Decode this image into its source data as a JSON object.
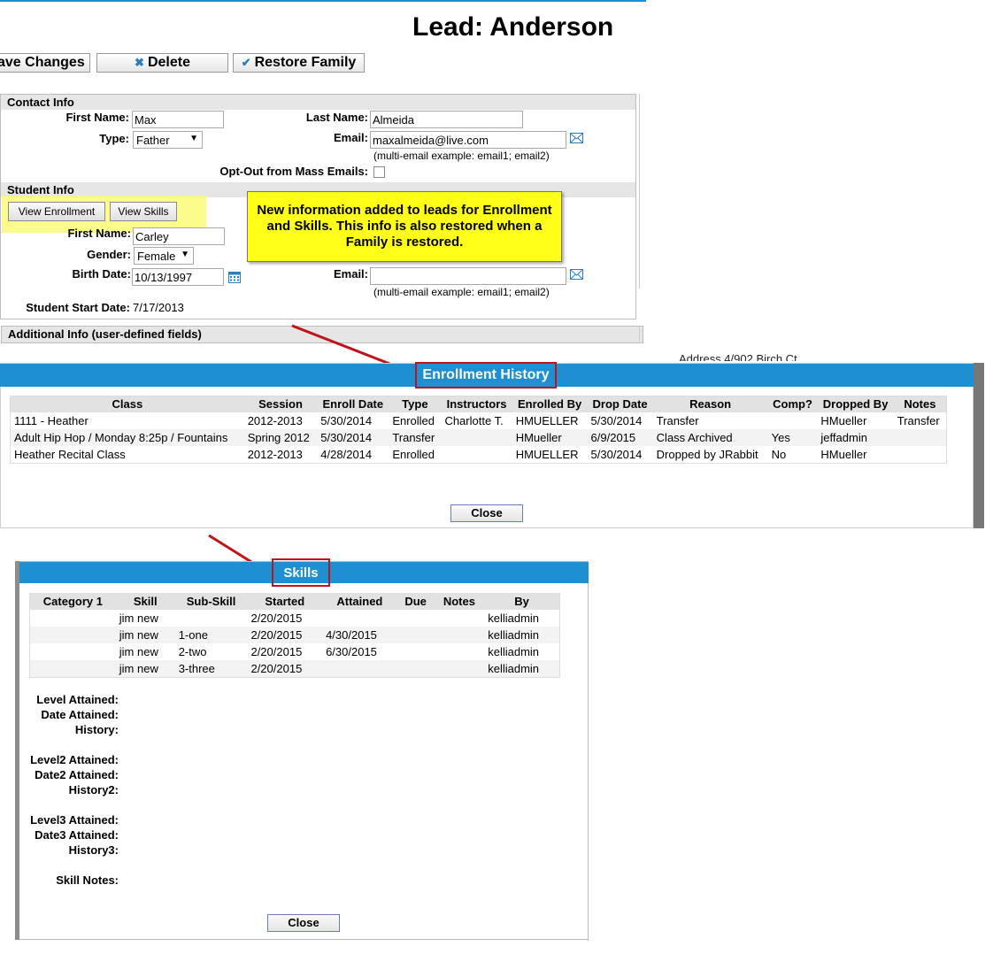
{
  "page": {
    "title": "Lead: Anderson",
    "toolbar": {
      "save_label": "ave Changes",
      "delete_label": "Delete",
      "restore_label": "Restore Family"
    }
  },
  "contact": {
    "section_title": "Contact Info",
    "first_name_label": "First Name:",
    "first_name": "Max",
    "last_name_label": "Last Name:",
    "last_name": "Almeida",
    "type_label": "Type:",
    "type": "Father",
    "email_label": "Email:",
    "email": "maxalmeida@live.com",
    "email_hint": "(multi-email example: email1; email2)",
    "optout_label": "Opt-Out from Mass Emails:"
  },
  "student": {
    "section_title": "Student Info",
    "view_enrollment": "View Enrollment",
    "view_skills": "View Skills",
    "first_name_label": "First Name:",
    "first_name": "Carley",
    "gender_label": "Gender:",
    "gender": "Female",
    "birth_label": "Birth Date:",
    "birth": "10/13/1997",
    "email_label": "Email:",
    "email_hint": "(multi-email example: email1; email2)",
    "start_label": "Student Start Date:",
    "start": "7/17/2013"
  },
  "additional": {
    "section_title": "Additional Info (user-defined fields)"
  },
  "callout": {
    "text": "New information added to leads for Enrollment and Skills. This info is also restored when a Family is restored."
  },
  "background": {
    "address_fragment": "Address 4/902 Birch Ct"
  },
  "enrollment": {
    "title": "Enrollment History",
    "columns": [
      "Class",
      "Session",
      "Enroll Date",
      "Type",
      "Instructors",
      "Enrolled By",
      "Drop Date",
      "Reason",
      "Comp?",
      "Dropped By",
      "Notes"
    ],
    "rows": [
      [
        "1111 - Heather",
        "2012-2013",
        "5/30/2014",
        "Enrolled",
        "Charlotte T.",
        "HMUELLER",
        "5/30/2014",
        "Transfer",
        "",
        "HMueller",
        "Transfer"
      ],
      [
        "Adult Hip Hop / Monday 8:25p / Fountains",
        "Spring 2012",
        "5/30/2014",
        "Transfer",
        "",
        "HMueller",
        "6/9/2015",
        "Class Archived",
        "Yes",
        "jeffadmin",
        ""
      ],
      [
        "Heather Recital Class",
        "2012-2013",
        "4/28/2014",
        "Enrolled",
        "",
        "HMUELLER",
        "5/30/2014",
        "Dropped by JRabbit",
        "No",
        "HMueller",
        ""
      ]
    ],
    "close_label": "Close"
  },
  "skills": {
    "title": "Skills",
    "columns": [
      "Category 1",
      "Skill",
      "Sub-Skill",
      "Started",
      "Attained",
      "Due",
      "Notes",
      "By"
    ],
    "rows": [
      [
        "",
        "jim new",
        "",
        "2/20/2015",
        "",
        "",
        "",
        "kelliadmin"
      ],
      [
        "",
        "jim new",
        "1-one",
        "2/20/2015",
        "4/30/2015",
        "",
        "",
        "kelliadmin"
      ],
      [
        "",
        "jim new",
        "2-two",
        "2/20/2015",
        "6/30/2015",
        "",
        "",
        "kelliadmin"
      ],
      [
        "",
        "jim new",
        "3-three",
        "2/20/2015",
        "",
        "",
        "",
        "kelliadmin"
      ]
    ],
    "labels": {
      "level": "Level Attained:",
      "date": "Date Attained:",
      "history": "History:",
      "level2": "Level2 Attained:",
      "date2": "Date2 Attained:",
      "history2": "History2:",
      "level3": "Level3 Attained:",
      "date3": "Date3 Attained:",
      "history3": "History3:",
      "notes": "Skill Notes:"
    },
    "close_label": "Close"
  },
  "colors": {
    "header_blue": "#1e8fd1",
    "callout_yellow": "#ffff1a",
    "highlight_red": "#c0141b"
  }
}
